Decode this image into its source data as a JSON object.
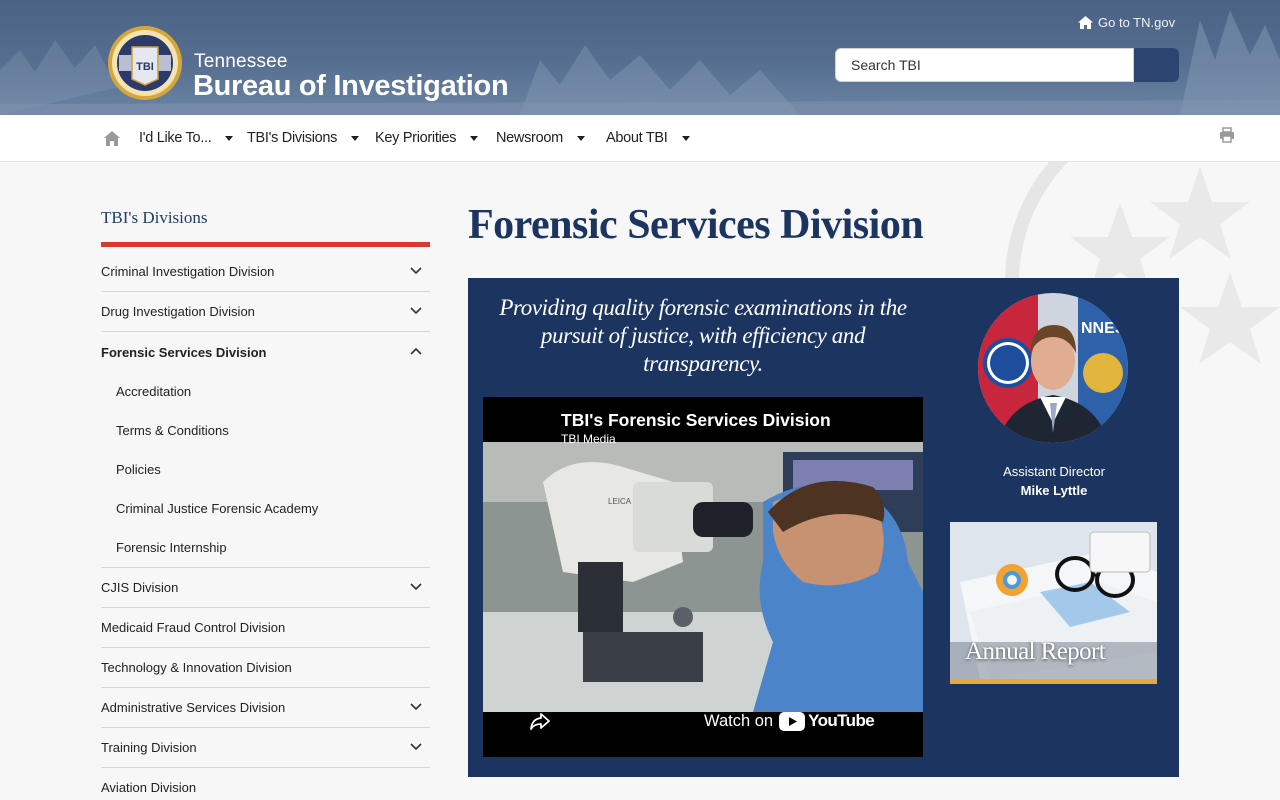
{
  "header": {
    "org_small": "Tennessee",
    "org_big": "Bureau of Investigation",
    "seal_text": "TBI",
    "tngov_link": "Go to TN.gov",
    "search": {
      "placeholder": "Search TBI",
      "value": ""
    }
  },
  "nav": {
    "items": [
      {
        "label": "I'd Like To..."
      },
      {
        "label": "TBI's Divisions"
      },
      {
        "label": "Key Priorities"
      },
      {
        "label": "Newsroom"
      },
      {
        "label": "About TBI"
      }
    ]
  },
  "sidebar": {
    "title": "TBI's Divisions",
    "items": [
      {
        "label": "Criminal Investigation Division"
      },
      {
        "label": "Drug Investigation Division"
      },
      {
        "label": "Forensic Services Division"
      },
      {
        "label": "CJIS Division"
      },
      {
        "label": "Medicaid Fraud Control Division"
      },
      {
        "label": "Technology & Innovation Division"
      },
      {
        "label": "Administrative Services Division"
      },
      {
        "label": "Training Division"
      },
      {
        "label": "Aviation Division"
      }
    ],
    "subitems": [
      {
        "label": "Accreditation"
      },
      {
        "label": "Terms & Conditions"
      },
      {
        "label": "Policies"
      },
      {
        "label": "Criminal Justice Forensic Academy"
      },
      {
        "label": "Forensic Internship"
      }
    ]
  },
  "main": {
    "page_title": "Forensic Services Division",
    "tagline": "Providing quality forensic examinations  in the pursuit of justice, with efficiency and transparency.",
    "video": {
      "title": "TBI's Forensic Services Division",
      "channel": "TBI Media",
      "watch_on": "Watch on",
      "youtube": "YouTube",
      "lens_text": "LEICA"
    },
    "director": {
      "role": "Assistant Director",
      "name": "Mike Lyttle",
      "flag_text": "NNES"
    },
    "annual_report": {
      "label": "Annual Report"
    }
  },
  "colors": {
    "brand_navy": "#1c3560",
    "accent_red": "#d93a30",
    "accent_gold": "#e5a93c",
    "search_button": "#2b4470"
  }
}
